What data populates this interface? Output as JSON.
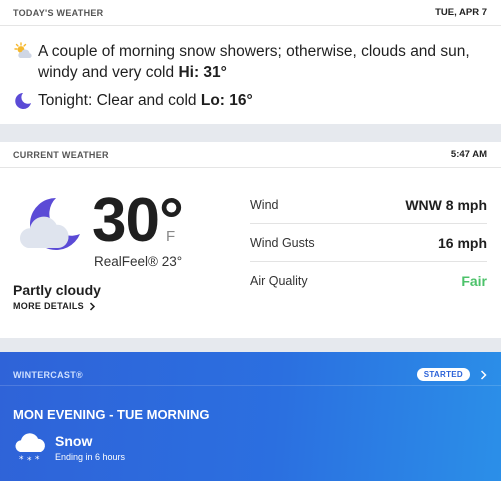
{
  "today": {
    "title": "TODAY'S WEATHER",
    "date": "TUE, APR 7",
    "day_text": "A couple of morning snow showers; otherwise, clouds and sun, windy and very cold",
    "day_hi_label": "Hi: 31°",
    "night_text": "Tonight: Clear and cold",
    "night_lo_label": "Lo: 16°",
    "day_icon": "partly-sunny-icon",
    "night_icon": "moon-icon"
  },
  "current": {
    "title": "CURRENT WEATHER",
    "time": "5:47 AM",
    "temperature": "30°",
    "unit": "F",
    "realfeel": "RealFeel® 23°",
    "condition": "Partly cloudy",
    "more_details": "MORE DETAILS",
    "icon": "partly-cloudy-night-icon",
    "stats": [
      {
        "label": "Wind",
        "value": "WNW 8 mph"
      },
      {
        "label": "Wind Gusts",
        "value": "16 mph"
      },
      {
        "label": "Air Quality",
        "value": "Fair",
        "color": "#4cc26a"
      }
    ]
  },
  "wintercast": {
    "title": "WINTERCAST®",
    "badge": "STARTED",
    "period": "MON EVENING - TUE MORNING",
    "precip_type": "Snow",
    "ending": "Ending in 6 hours",
    "icon": "snow-cloud-icon"
  },
  "colors": {
    "accent_blue": "#2b6fe0",
    "moon_purple": "#5b4bd6",
    "air_quality_fair": "#4cc26a"
  }
}
